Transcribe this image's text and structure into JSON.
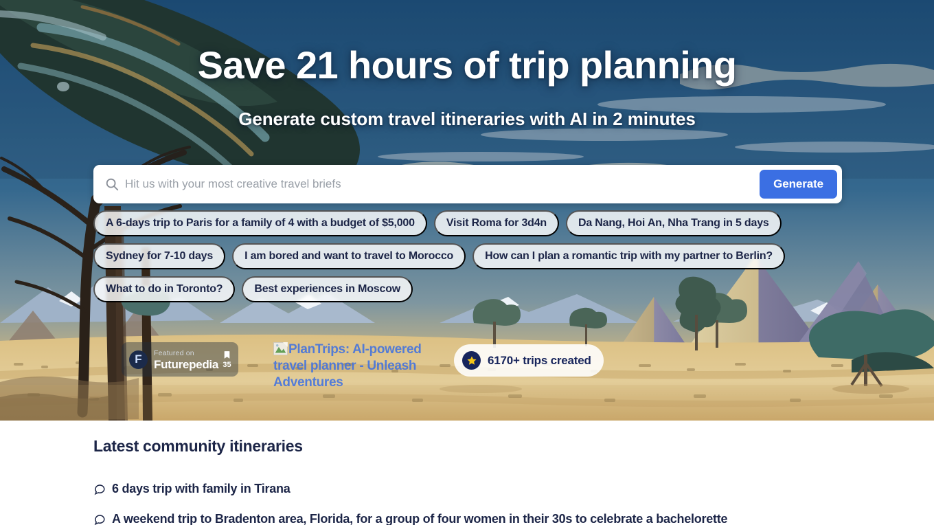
{
  "hero": {
    "headline": "Save 21 hours of trip planning",
    "subheadline": "Generate custom travel itineraries with AI in 2 minutes",
    "search": {
      "placeholder": "Hit us with your most creative travel briefs",
      "value": "",
      "icon": "search-icon",
      "generate_label": "Generate"
    },
    "suggestion_chips": [
      {
        "label": "A 6-days trip to Paris for a family of 4 with a budget of $5,000"
      },
      {
        "label": "Visit Roma for 3d4n"
      },
      {
        "label": "Da Nang, Hoi An, Nha Trang in 5 days"
      },
      {
        "label": "Sydney for 7-10 days"
      },
      {
        "label": "I am bored and want to travel to Morocco"
      },
      {
        "label": "How can I plan a romantic trip with my partner to Berlin?"
      },
      {
        "label": "What to do in Toronto?"
      },
      {
        "label": "Best experiences in Moscow"
      }
    ],
    "futurepedia_badge": {
      "logo_letter": "F",
      "featured_on": "Featured on",
      "site_name": "Futurepedia",
      "bookmark_icon": "bookmark-icon",
      "vote_count": "35"
    },
    "broken_image": {
      "alt_text": "PlanTrips: AI-powered travel planner - Unleash Adventures",
      "icon": "broken-image-icon"
    },
    "trips_badge": {
      "star_icon": "star-icon",
      "label": "6170+ trips created"
    }
  },
  "community": {
    "title": "Latest community itineraries",
    "items": [
      {
        "icon": "chat-bubble-icon",
        "label": "6 days trip with family in Tirana"
      },
      {
        "icon": "chat-bubble-icon",
        "label": "A weekend trip to Bradenton area, Florida, for a group of four women in their 30s to celebrate a bachelorette"
      }
    ]
  },
  "colors": {
    "accent_blue": "#3b6fe3",
    "text_navy": "#1c2547",
    "badge_navy": "#17255c",
    "star_yellow": "#f5c518",
    "sky_blue": "#2d5f85",
    "sand": "#d6b877"
  }
}
